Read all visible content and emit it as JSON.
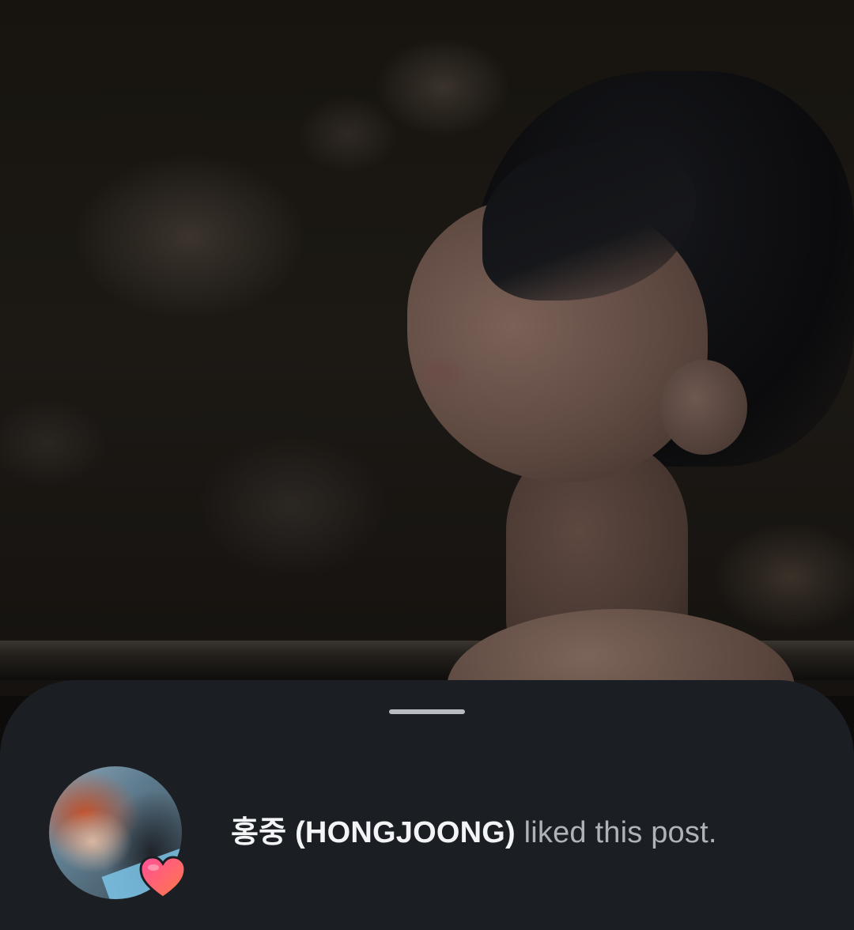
{
  "activity": {
    "username": "홍중 (HONGJOONG)",
    "action_text": " liked this post.",
    "badge_icon": "heart-icon",
    "badge_colors": [
      "#ff4f9a",
      "#ff7a45"
    ]
  },
  "colors": {
    "sheet_background": "#1b1f23",
    "handle": "#b8bcc1",
    "username_text": "#f3f4f6",
    "action_text": "#aeb3b9"
  }
}
